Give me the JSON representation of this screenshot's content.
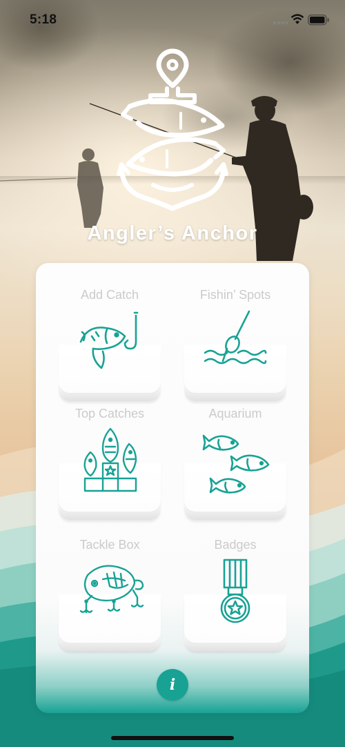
{
  "status_bar": {
    "time": "5:18"
  },
  "app": {
    "title": "Angler’s Anchor",
    "logo_icon": "anchor-fish-logo-icon"
  },
  "menu": [
    {
      "label": "Add Catch",
      "icon": "fish-hook-icon"
    },
    {
      "label": "Fishin’ Spots",
      "icon": "bobber-icon"
    },
    {
      "label": "Top Catches",
      "icon": "podium-icon"
    },
    {
      "label": "Aquarium",
      "icon": "fish-school-icon"
    },
    {
      "label": "Tackle Box",
      "icon": "lure-icon"
    },
    {
      "label": "Badges",
      "icon": "medal-icon"
    }
  ],
  "info_button": {
    "label": "i",
    "icon": "info-icon"
  },
  "colors": {
    "accent": "#17a294",
    "tile_label": "#cbcbcb",
    "title": "#ffffff"
  }
}
